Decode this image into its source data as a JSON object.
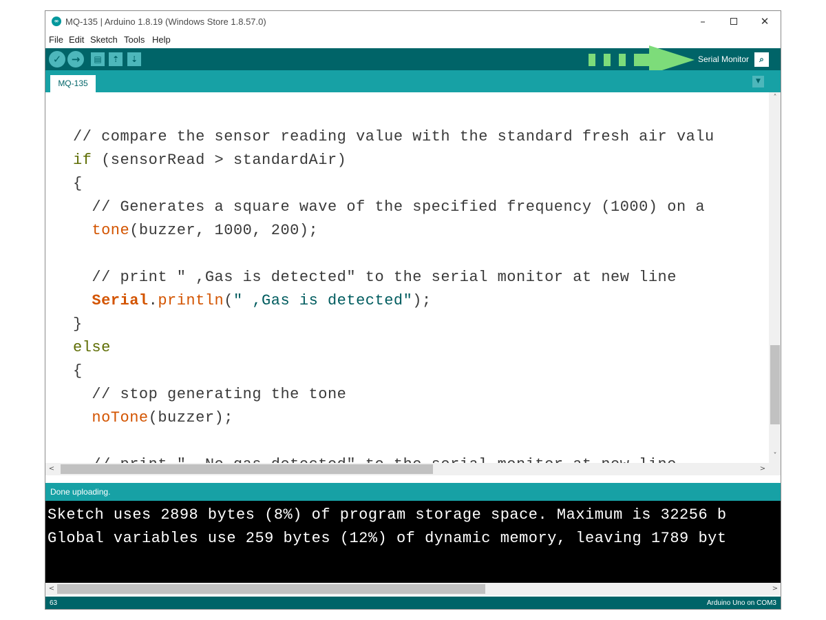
{
  "window": {
    "title": "MQ-135 | Arduino 1.8.19 (Windows Store 1.8.57.0)",
    "controls": {
      "minimize": "–",
      "maximize": "",
      "close": "✕"
    }
  },
  "menu": [
    "File",
    "Edit",
    "Sketch",
    "Tools",
    "Help"
  ],
  "toolbar": {
    "verify_icon": "✓",
    "upload_icon": "→",
    "new_icon": "▤",
    "open_icon": "⇡",
    "save_icon": "⇣",
    "serial_monitor_label": "Serial Monitor",
    "serial_monitor_icon": "⌕"
  },
  "tabs": {
    "active": "MQ-135",
    "menu_icon": "▼"
  },
  "editor": {
    "lines": [
      [
        {
          "t": "// compare the sensor reading value with the standard fresh air valu",
          "c": "comment"
        }
      ],
      [
        {
          "t": "if",
          "c": "kw"
        },
        {
          "t": " (sensorRead > standardAir)",
          "c": "plain"
        }
      ],
      [
        {
          "t": "{",
          "c": "plain"
        }
      ],
      [
        {
          "t": "  // Generates a square wave of the specified frequency (1000) on a",
          "c": "comment"
        }
      ],
      [
        {
          "t": "  ",
          "c": "plain"
        },
        {
          "t": "tone",
          "c": "fn"
        },
        {
          "t": "(buzzer, 1000, 200);",
          "c": "plain"
        }
      ],
      [
        {
          "t": "",
          "c": "plain"
        }
      ],
      [
        {
          "t": "  // print \" ,Gas is detected\" to the serial monitor at new line",
          "c": "comment"
        }
      ],
      [
        {
          "t": "  ",
          "c": "plain"
        },
        {
          "t": "Serial",
          "c": "class"
        },
        {
          "t": ".",
          "c": "plain"
        },
        {
          "t": "println",
          "c": "fn"
        },
        {
          "t": "(",
          "c": "plain"
        },
        {
          "t": "\" ,Gas is detected\"",
          "c": "str"
        },
        {
          "t": ");",
          "c": "plain"
        }
      ],
      [
        {
          "t": "}",
          "c": "plain"
        }
      ],
      [
        {
          "t": "else",
          "c": "kw"
        }
      ],
      [
        {
          "t": "{",
          "c": "plain"
        }
      ],
      [
        {
          "t": "  // stop generating the tone",
          "c": "comment"
        }
      ],
      [
        {
          "t": "  ",
          "c": "plain"
        },
        {
          "t": "noTone",
          "c": "fn"
        },
        {
          "t": "(buzzer);",
          "c": "plain"
        }
      ],
      [
        {
          "t": "",
          "c": "plain"
        }
      ],
      [
        {
          "t": "  // print \" ,No gas detected\" to the serial monitor at new line",
          "c": "comment"
        }
      ]
    ]
  },
  "scroll": {
    "up": "˄",
    "down": "˅",
    "left": "<",
    "right": ">"
  },
  "status": {
    "message": "Done uploading."
  },
  "console": {
    "lines": [
      "Sketch uses 2898 bytes (8%) of program storage space. Maximum is 32256 b",
      "Global variables use 259 bytes (12%) of dynamic memory, leaving 1789 byt"
    ]
  },
  "footer": {
    "line_number": "63",
    "board": "Arduino Uno on COM3"
  },
  "colors": {
    "toolbar": "#006468",
    "tabbar": "#17a1a5",
    "annotation_arrow": "#7ddc7a",
    "keyword": "#5e6d03",
    "function": "#d35400",
    "string": "#005c5f"
  }
}
